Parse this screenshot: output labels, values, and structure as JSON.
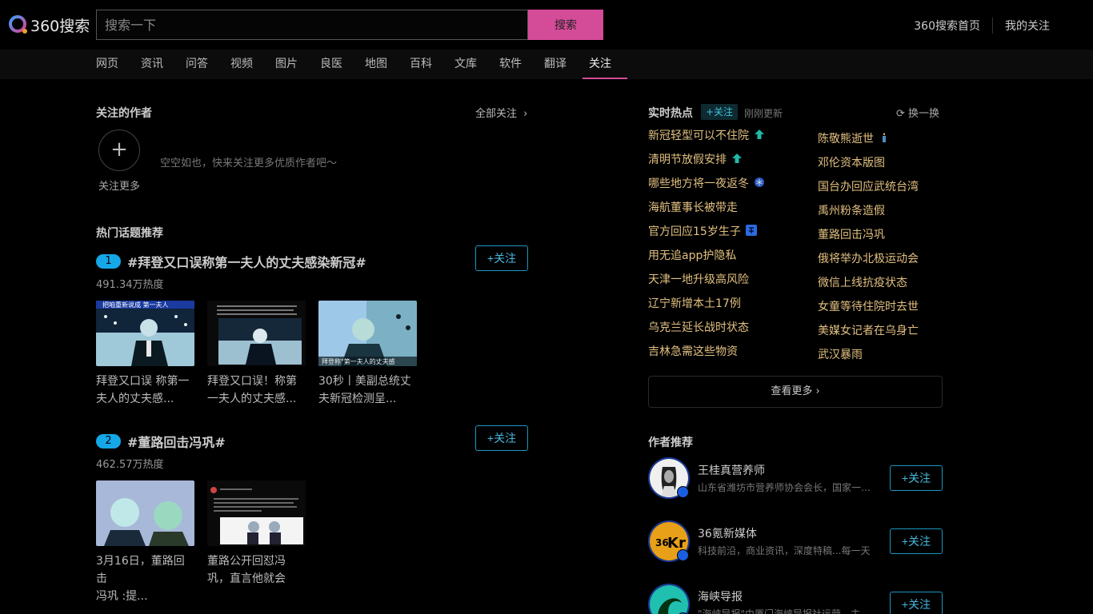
{
  "header": {
    "logo_text": "360搜索",
    "search_placeholder": "搜索一下",
    "search_button": "搜索",
    "links": [
      "360搜索首页",
      "我的关注"
    ]
  },
  "nav": {
    "tabs": [
      "网页",
      "资讯",
      "问答",
      "视频",
      "图片",
      "良医",
      "地图",
      "百科",
      "文库",
      "软件",
      "翻译",
      "关注"
    ],
    "active": "关注"
  },
  "follow_authors": {
    "title": "关注的作者",
    "all_link": "全部关注",
    "add_label": "关注更多",
    "empty_text": "空空如也，快来关注更多优质作者吧～"
  },
  "hot_topics": {
    "title": "热门话题推荐",
    "follow_label": "+关注",
    "items": [
      {
        "rank": "1",
        "title": "#拜登又口误称第一夫人的丈夫感染新冠#",
        "heat": "491.34万热度",
        "thumbs": [
          {
            "caption_1": "拜登又口误 称第一",
            "caption_2": "夫人的丈夫感...",
            "overlay": "把咱重新说成 第一夫人"
          },
          {
            "caption_1": "拜登又口误！称第",
            "caption_2": "一夫人的丈夫感...",
            "overlay": ""
          },
          {
            "caption_1": "30秒丨美副总统丈",
            "caption_2": "夫新冠检测呈...",
            "overlay": "拜登称\"第一夫人的丈夫感"
          }
        ]
      },
      {
        "rank": "2",
        "title": "#董路回击冯巩#",
        "heat": "462.57万热度",
        "thumbs": [
          {
            "caption_1": "3月16日，董路回击",
            "caption_2": "冯巩 :提...",
            "overlay": ""
          },
          {
            "caption_1": "董路公开回怼冯",
            "caption_2": "巩，直言他就会",
            "overlay": ""
          }
        ]
      }
    ]
  },
  "realtime_hot": {
    "title": "实时热点",
    "follow_label": "+关注",
    "updated": "刚刚更新",
    "refresh": "换一换",
    "left": [
      "新冠轻型可以不住院",
      "清明节放假安排",
      "哪些地方将一夜返冬",
      "海航董事长被带走",
      "官方回应15岁生子",
      "用无追app护隐私",
      "天津一地升级高风险",
      "辽宁新增本土17例",
      "乌克兰延长战时状态",
      "吉林急需这些物资"
    ],
    "right": [
      "陈敬熊逝世",
      "邓伦资本版图",
      "国台办回应武统台湾",
      "禹州粉条造假",
      "董路回击冯巩",
      "俄将举办北极运动会",
      "微信上线抗疫状态",
      "女童等待住院时去世",
      "美媒女记者在乌身亡",
      "武汉暴雨"
    ],
    "see_more": "查看更多",
    "colors": {
      "text": "#e2c080",
      "up_arrow": "#1fb8a8",
      "hot_badge": "#2a6ae0"
    }
  },
  "author_rec": {
    "title": "作者推荐",
    "follow_label": "+关注",
    "items": [
      {
        "name": "王桂真营养师",
        "desc": "山东省潍坊市营养师协会会长，国家一级营养师"
      },
      {
        "name": "36氪新媒体",
        "desc": "科技前沿，商业资讯，深度特稿...每一天"
      },
      {
        "name": "海峡导报",
        "desc": "\"海峡导报\"由厦门海峡导报社运营，主"
      }
    ]
  }
}
